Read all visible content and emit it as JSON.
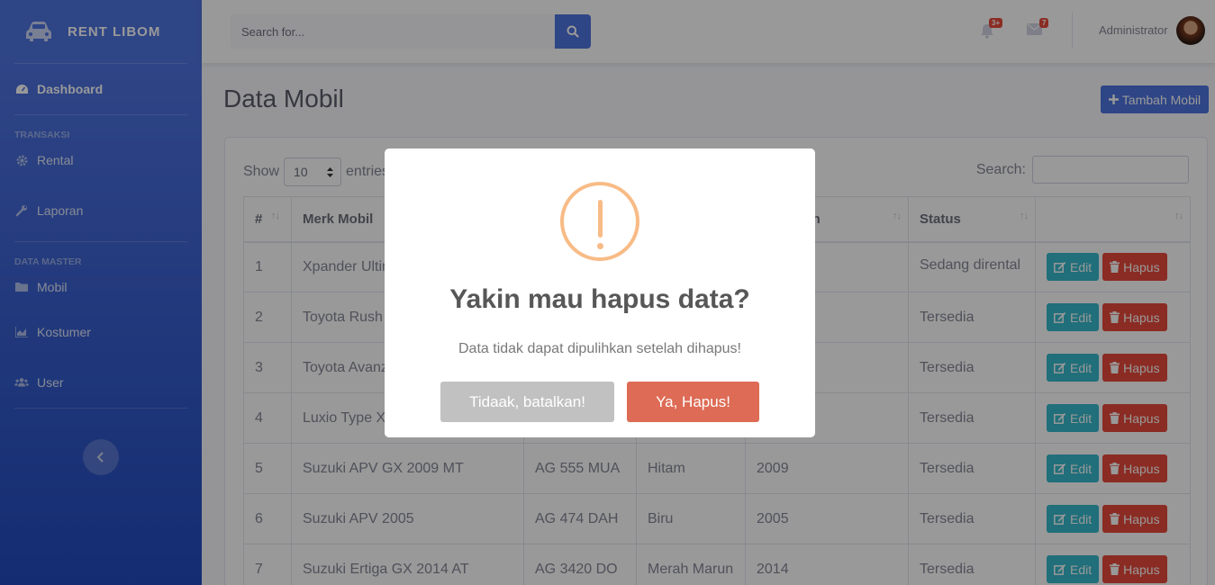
{
  "brand": {
    "name": "RENT LIBOM",
    "logo_icon": "car-icon"
  },
  "sidebar": {
    "dashboard": "Dashboard",
    "heading_transaksi": "TRANSAKSI",
    "rental": "Rental",
    "laporan": "Laporan",
    "heading_master": "DATA MASTER",
    "mobil": "Mobil",
    "kostumer": "Kostumer",
    "user": "User"
  },
  "topbar": {
    "search_placeholder": "Search for...",
    "alerts_badge": "3+",
    "messages_badge": "7",
    "username": "Administrator"
  },
  "page": {
    "title": "Data Mobil",
    "add_button": "Tambah Mobil"
  },
  "table_controls": {
    "show_label": "Show",
    "entries_value": "10",
    "entries_label": "entries",
    "search_label": "Search:"
  },
  "table": {
    "headers": [
      "#",
      "Merk Mobil",
      "",
      "",
      "embuatan",
      "Status",
      ""
    ],
    "rows": [
      {
        "no": "1",
        "merk": "Xpander Ultir",
        "plat": "",
        "warna": "",
        "tahun": "",
        "status": "Sedang dirental"
      },
      {
        "no": "2",
        "merk": "Toyota Rush",
        "plat": "",
        "warna": "",
        "tahun": "",
        "status": "Tersedia"
      },
      {
        "no": "3",
        "merk": "Toyota Avanz",
        "plat": "",
        "warna": "",
        "tahun": "",
        "status": "Tersedia"
      },
      {
        "no": "4",
        "merk": "Luxio Type X",
        "plat": "",
        "warna": "",
        "tahun": "",
        "status": "Tersedia"
      },
      {
        "no": "5",
        "merk": "Suzuki APV GX 2009 MT",
        "plat": "AG 555 MUA",
        "warna": "Hitam",
        "tahun": "2009",
        "status": "Tersedia"
      },
      {
        "no": "6",
        "merk": "Suzuki APV 2005",
        "plat": "AG 474 DAH",
        "warna": "Biru",
        "tahun": "2005",
        "status": "Tersedia"
      },
      {
        "no": "7",
        "merk": "Suzuki Ertiga GX 2014 AT",
        "plat": "AG 3420 DO",
        "warna": "Merah Marun",
        "tahun": "2014",
        "status": "Tersedia"
      }
    ],
    "edit_label": "Edit",
    "hapus_label": "Hapus"
  },
  "modal": {
    "title": "Yakin mau hapus data?",
    "text": "Data tidak dapat dipulihkan setelah dihapus!",
    "cancel_label": "Tidaak, batalkan!",
    "confirm_label": "Ya, Hapus!"
  },
  "colors": {
    "primary": "#4e73df",
    "info": "#36b9cc",
    "danger": "#e74a3b",
    "warning_icon": "#f8bb86",
    "confirm": "#dd6b55",
    "cancel": "#c1c1c1"
  }
}
